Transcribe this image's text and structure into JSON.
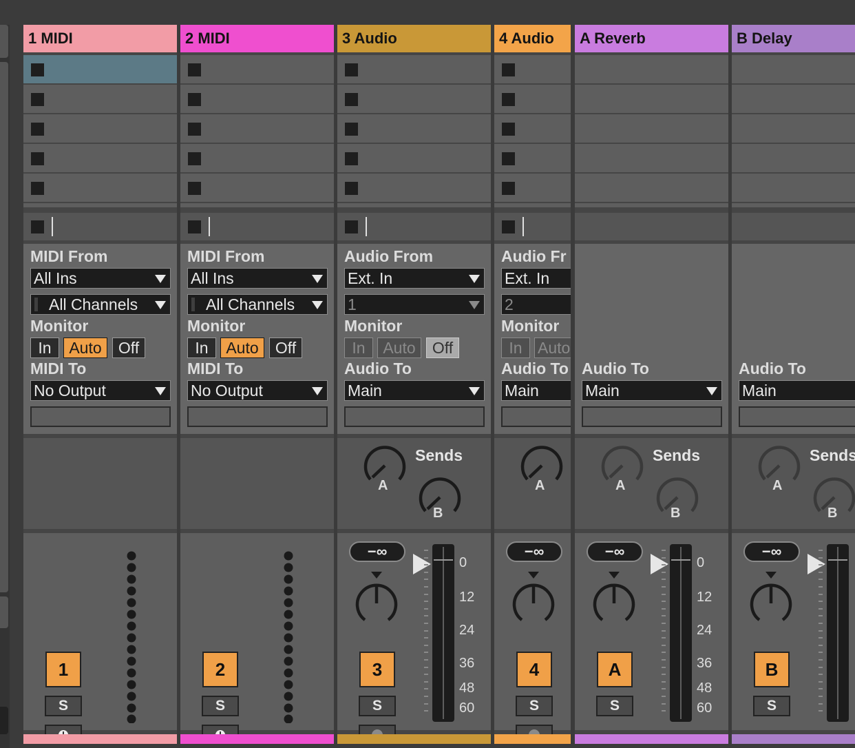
{
  "colors": {
    "t1": "#f29ca6",
    "t2": "#ef4fcf",
    "t3": "#c99837",
    "t4": "#f3a449",
    "tA": "#c97cdf",
    "tB": "#a97fc9",
    "accent": "#f0a048"
  },
  "tracks": {
    "t1": {
      "title": "1 MIDI",
      "from_label": "MIDI From",
      "from": "All Ins",
      "channel": "All Channels",
      "monitor_label": "Monitor",
      "mon_in": "In",
      "mon_auto": "Auto",
      "mon_off": "Off",
      "to_label": "MIDI To",
      "to": "No Output",
      "number": "1",
      "solo": "S"
    },
    "t2": {
      "title": "2 MIDI",
      "from_label": "MIDI From",
      "from": "All Ins",
      "channel": "All Channels",
      "monitor_label": "Monitor",
      "mon_in": "In",
      "mon_auto": "Auto",
      "mon_off": "Off",
      "to_label": "MIDI To",
      "to": "No Output",
      "number": "2",
      "solo": "S"
    },
    "t3": {
      "title": "3 Audio",
      "from_label": "Audio From",
      "from": "Ext. In",
      "channel": "1",
      "monitor_label": "Monitor",
      "mon_in": "In",
      "mon_auto": "Auto",
      "mon_off": "Off",
      "to_label": "Audio To",
      "to": "Main",
      "sends_label": "Sends",
      "send_a": "A",
      "send_b": "B",
      "volume": "−∞",
      "number": "3",
      "solo": "S"
    },
    "t4": {
      "title": "4 Audio",
      "from_label": "Audio Fr",
      "from": "Ext. In",
      "channel": "2",
      "monitor_label": "Monitor",
      "mon_in": "In",
      "mon_auto": "Auto",
      "to_label": "Audio To",
      "to": "Main",
      "send_a": "A",
      "volume": "−∞",
      "number": "4",
      "solo": "S"
    },
    "tA": {
      "title": "A Reverb",
      "to_label": "Audio To",
      "to": "Main",
      "sends_label": "Sends",
      "send_a": "A",
      "send_b": "B",
      "volume": "−∞",
      "number": "A",
      "solo": "S"
    },
    "tB": {
      "title": "B Delay",
      "to_label": "Audio To",
      "to": "Main",
      "sends_label": "Sends",
      "send_a": "A",
      "send_b": "B",
      "volume": "−∞",
      "number": "B",
      "solo": "S"
    }
  },
  "meter_scale": [
    "0",
    "12",
    "24",
    "36",
    "48",
    "60"
  ]
}
